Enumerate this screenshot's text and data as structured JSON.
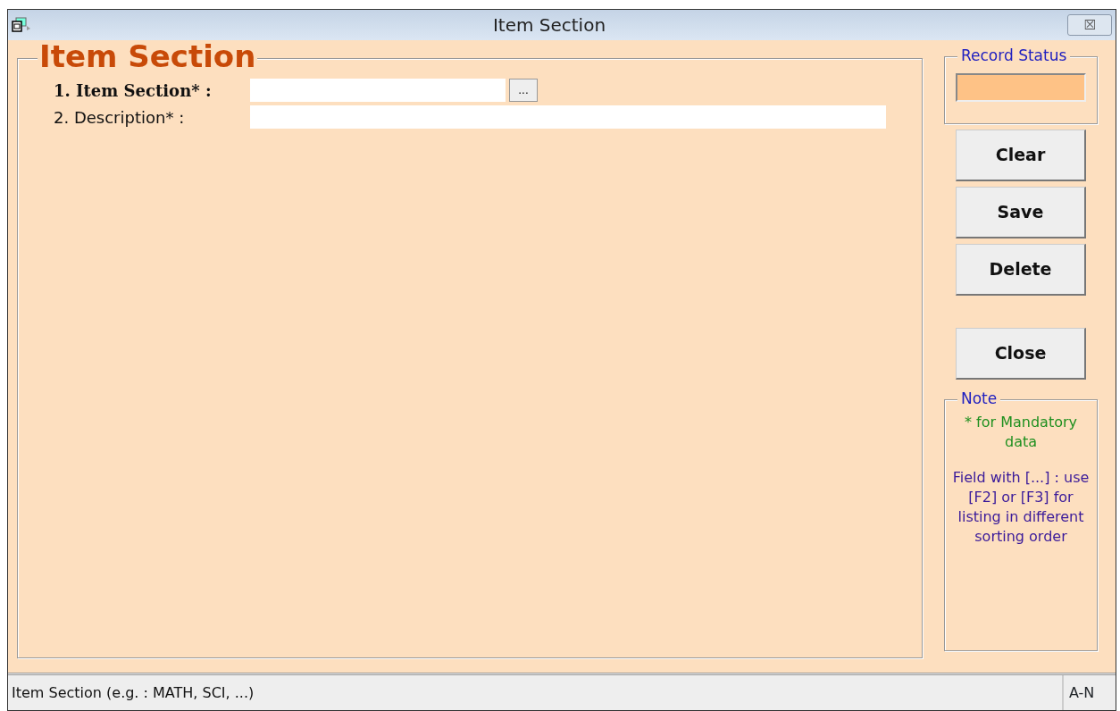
{
  "window": {
    "title": "Item Section",
    "close_symbol": "⮽"
  },
  "form": {
    "title": "Item Section",
    "fields": [
      {
        "label": "1. Item Section* :",
        "bold": true,
        "lookup_button": "..."
      },
      {
        "label": "2. Description* :",
        "bold": false
      }
    ]
  },
  "record_status": {
    "title": "Record Status"
  },
  "buttons": [
    {
      "label": "Clear"
    },
    {
      "label": "Save"
    },
    {
      "label": "Delete"
    },
    {
      "label": "Close"
    }
  ],
  "note": {
    "title": "Note",
    "lines": [
      {
        "text": "* for Mandatory data",
        "color": "#209020"
      },
      {
        "text": "Field with [...] : use [F2] or [F3] for listing in different sorting order",
        "color": "#3a1a9a"
      }
    ]
  },
  "status_bar": {
    "hint": "Item Section (e.g. : MATH, SCI, ...)",
    "mode": "A-N"
  }
}
